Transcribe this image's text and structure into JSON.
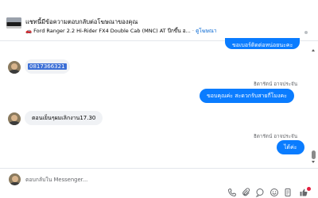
{
  "banner": {
    "title": "แชทนี้มีข้อความตอบกลับต่อโฆษณาของคุณ",
    "car_icon": "🚗",
    "listing": "Ford Ranger 2.2 Hi-Rider FX4 Double Cab (MNC) AT ปีกขึ้น อ...",
    "separator": "·",
    "link": "ดูโฆษณา"
  },
  "messages": [
    {
      "id": "out-1",
      "direction": "outgoing",
      "text": "ขอเบอร์ติดต่อหน่อยนะคะ",
      "partially_hidden": true
    },
    {
      "id": "in-1",
      "direction": "incoming",
      "text": "0817366321",
      "selected": true
    },
    {
      "id": "out-2",
      "direction": "outgoing",
      "sender": "ธิดารัตน์ อาจประจัน",
      "text": "ขอบคุณค่ะ สะดวกรับสายกี่โมงคะ"
    },
    {
      "id": "in-2",
      "direction": "incoming",
      "text": "ตอนเย็นๆผมเลิกงาน17.30"
    },
    {
      "id": "out-3",
      "direction": "outgoing",
      "sender": "ธิดารัตน์ อาจประจัน",
      "text": "ได้ค่ะ"
    }
  ],
  "composer": {
    "placeholder": "ตอบกลับใน Messenger...",
    "tools": [
      "phone-icon",
      "attachment-icon",
      "message-icon",
      "emoji-icon",
      "gif-icon",
      "like-icon"
    ]
  },
  "colors": {
    "outgoing_bubble": "#0a7cff",
    "incoming_bubble": "#f0f2f5",
    "link": "#0064d1",
    "selection": "#3c6fd6",
    "badge": "#e41e3f"
  }
}
